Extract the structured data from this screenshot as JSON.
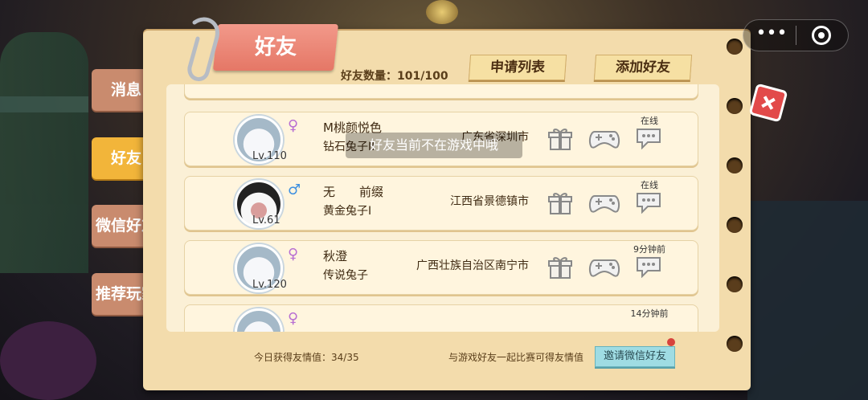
{
  "header": {
    "title": "好友",
    "friend_count_label": "好友数量：",
    "friend_count_value": "101/100",
    "apply_list_label": "申请列表",
    "add_friend_label": "添加好友"
  },
  "tabs": [
    {
      "label": "消息",
      "active": false
    },
    {
      "label": "好友",
      "active": true
    },
    {
      "label": "微信好友",
      "active": false
    },
    {
      "label": "推荐玩家",
      "active": false
    }
  ],
  "friends": [
    {
      "name": "M桃颜悦色",
      "rank": "钻石兔子II",
      "location": "广东省深圳市",
      "level": "Lv.110",
      "gender": "♀",
      "status": "在线",
      "avatar": "rabbit-avatar"
    },
    {
      "name": "无　　前缀",
      "rank": "黄金兔子I",
      "location": "江西省景德镇市",
      "level": "Lv.61",
      "gender": "♂",
      "status": "在线",
      "avatar": "cow-avatar"
    },
    {
      "name": "秋澄",
      "rank": "传说兔子",
      "location": "广西壮族自治区南宁市",
      "level": "Lv.120",
      "gender": "♀",
      "status": "9分钟前",
      "avatar": "rabbit-avatar"
    },
    {
      "name": "",
      "rank": "",
      "location": "",
      "level": "",
      "gender": "♀",
      "status": "14分钟前",
      "avatar": "rabbit-avatar"
    }
  ],
  "toast": "好友当前不在游戏中哦",
  "footer": {
    "left_text": "今日获得友情值：34/35",
    "right_text": "与游戏好友一起比赛可得友情值",
    "invite_button": "邀请微信好友"
  },
  "colors": {
    "panel": "#f3dcac",
    "ribbon": "#e57766",
    "active_tab": "#f2b53a",
    "inactive_tab": "#c98b6e",
    "invite": "#9fdce3"
  }
}
